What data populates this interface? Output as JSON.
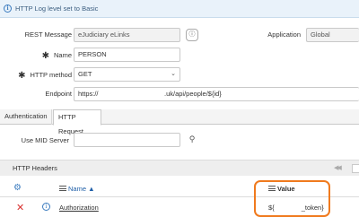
{
  "banner": {
    "text": "HTTP Log level set to Basic"
  },
  "form": {
    "rest_message_label": "REST Message",
    "rest_message_value": "eJudiciary eLinks",
    "application_label": "Application",
    "application_value": "Global",
    "name_label": "Name",
    "name_value": "PERSON",
    "method_label": "HTTP method",
    "method_value": "GET",
    "endpoint_label": "Endpoint",
    "endpoint_value_start": "https://",
    "endpoint_value_end": ".uk/api/people/${id}",
    "required_marker": "✱"
  },
  "tabs": [
    {
      "label": "Authentication"
    },
    {
      "label": "HTTP Request"
    }
  ],
  "request": {
    "mid_server_label": "Use MID Server",
    "mid_server_value": ""
  },
  "headers_section": {
    "title": "HTTP Headers",
    "pager_symbol": "◀◀"
  },
  "table": {
    "name_header": "Name ▲",
    "value_header": "Value",
    "rows": [
      {
        "delete_symbol": "✕",
        "info_symbol": "i",
        "name": "Authorization",
        "value_start": "${",
        "value_end": "_token}"
      }
    ]
  }
}
